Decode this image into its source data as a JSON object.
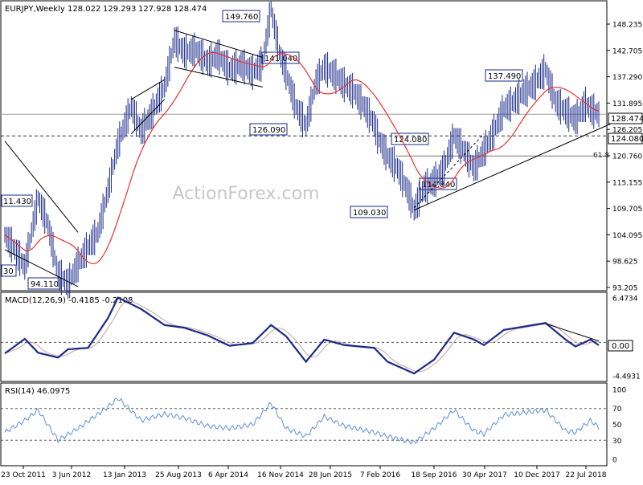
{
  "chart_data": {
    "type": "line",
    "symbol": "EURJPY",
    "timeframe": "Weekly",
    "ohlc_readout": {
      "open": "128.022",
      "high": "129.293",
      "low": "127.928",
      "close": "128.474"
    },
    "watermark": "ActionForex.com",
    "colors": {
      "price": "#1a2a8a",
      "sma": "#e8312f",
      "macd": "#1a2a8a",
      "signal": "#c8a0a0",
      "rsi": "#5b8fd9",
      "trendline": "#000000",
      "label_border": "#1a2a8a",
      "grid": "#808080"
    },
    "x_ticks": [
      "23 Oct 2011",
      "3 Jun 2012",
      "13 Jan 2013",
      "25 Aug 2013",
      "6 Apr 2014",
      "16 Nov 2014",
      "28 Jun 2015",
      "7 Feb 2016",
      "18 Sep 2016",
      "30 Apr 2017",
      "10 Dec 2017",
      "22 Jul 2018"
    ],
    "price_panel": {
      "ylim": [
        93.0,
        151.0
      ],
      "y_ticks": [
        "148.235",
        "142.705",
        "137.290",
        "131.895",
        "126.205",
        "120.760",
        "115.155",
        "109.705",
        "104.095",
        "98.625",
        "93.205"
      ],
      "last_price_label": "128.474",
      "level_label": "124.080",
      "level": 124.08,
      "fib_label": "61.8",
      "fib_level": 120.0,
      "swing_labels": [
        "149.760",
        "141.040",
        "126.090",
        "137.490",
        "124.080",
        "114.840",
        "109.030",
        "11.430",
        "94.110",
        "30"
      ],
      "key_points": [
        {
          "date": "2011-10-23",
          "value": 104.0
        },
        {
          "date": "2011-12-04",
          "value": 101.0
        },
        {
          "date": "2012-01-15",
          "value": 97.5
        },
        {
          "date": "2012-03-11",
          "value": 111.4
        },
        {
          "date": "2012-04-22",
          "value": 106.0
        },
        {
          "date": "2012-06-03",
          "value": 96.0
        },
        {
          "date": "2012-07-15",
          "value": 94.11
        },
        {
          "date": "2012-08-26",
          "value": 98.0
        },
        {
          "date": "2012-10-07",
          "value": 101.5
        },
        {
          "date": "2012-11-18",
          "value": 104.5
        },
        {
          "date": "2012-12-30",
          "value": 113.0
        },
        {
          "date": "2013-02-10",
          "value": 122.5
        },
        {
          "date": "2013-04-07",
          "value": 130.0
        },
        {
          "date": "2013-05-19",
          "value": 125.0
        },
        {
          "date": "2013-06-30",
          "value": 128.5
        },
        {
          "date": "2013-08-25",
          "value": 134.0
        },
        {
          "date": "2013-10-06",
          "value": 143.5
        },
        {
          "date": "2013-11-17",
          "value": 141.0
        },
        {
          "date": "2014-01-05",
          "value": 141.5
        },
        {
          "date": "2014-02-23",
          "value": 139.0
        },
        {
          "date": "2014-04-06",
          "value": 140.5
        },
        {
          "date": "2014-05-25",
          "value": 137.5
        },
        {
          "date": "2014-07-13",
          "value": 138.5
        },
        {
          "date": "2014-08-31",
          "value": 137.0
        },
        {
          "date": "2014-10-12",
          "value": 139.0
        },
        {
          "date": "2014-11-16",
          "value": 149.76
        },
        {
          "date": "2014-12-21",
          "value": 141.04
        },
        {
          "date": "2015-01-18",
          "value": 137.0
        },
        {
          "date": "2015-03-01",
          "value": 130.0
        },
        {
          "date": "2015-04-12",
          "value": 126.09
        },
        {
          "date": "2015-05-24",
          "value": 135.0
        },
        {
          "date": "2015-06-28",
          "value": 138.0
        },
        {
          "date": "2015-08-09",
          "value": 136.5
        },
        {
          "date": "2015-09-20",
          "value": 134.5
        },
        {
          "date": "2015-11-01",
          "value": 133.0
        },
        {
          "date": "2015-12-13",
          "value": 130.0
        },
        {
          "date": "2016-01-24",
          "value": 126.5
        },
        {
          "date": "2016-02-07",
          "value": 124.0
        },
        {
          "date": "2016-03-20",
          "value": 120.0
        },
        {
          "date": "2016-05-01",
          "value": 117.5
        },
        {
          "date": "2016-06-12",
          "value": 113.0
        },
        {
          "date": "2016-07-10",
          "value": 109.03
        },
        {
          "date": "2016-08-21",
          "value": 113.5
        },
        {
          "date": "2016-10-02",
          "value": 114.84
        },
        {
          "date": "2016-11-13",
          "value": 117.5
        },
        {
          "date": "2016-12-25",
          "value": 124.08
        },
        {
          "date": "2017-02-05",
          "value": 121.0
        },
        {
          "date": "2017-03-19",
          "value": 117.5
        },
        {
          "date": "2017-04-30",
          "value": 121.0
        },
        {
          "date": "2017-06-11",
          "value": 125.0
        },
        {
          "date": "2017-07-23",
          "value": 129.5
        },
        {
          "date": "2017-09-03",
          "value": 131.0
        },
        {
          "date": "2017-10-15",
          "value": 133.0
        },
        {
          "date": "2017-11-26",
          "value": 134.5
        },
        {
          "date": "2018-01-14",
          "value": 137.49
        },
        {
          "date": "2018-02-25",
          "value": 131.0
        },
        {
          "date": "2018-04-08",
          "value": 129.0
        },
        {
          "date": "2018-05-20",
          "value": 127.5
        },
        {
          "date": "2018-07-01",
          "value": 130.5
        },
        {
          "date": "2018-07-22",
          "value": 129.5
        },
        {
          "date": "2018-08-26",
          "value": 128.474
        }
      ]
    },
    "macd_panel": {
      "title": "MACD(12,26,9) -0.4185 -0.2108",
      "ylim": [
        -5.3,
        7.0
      ],
      "y_ticks": [
        "6.4734",
        "0.00",
        "-4.4931"
      ],
      "zero_label": "0.00",
      "key_points": [
        {
          "date": "2011-10-23",
          "value": -1.6
        },
        {
          "date": "2012-01-15",
          "value": 0.5
        },
        {
          "date": "2012-03-11",
          "value": -1.5
        },
        {
          "date": "2012-06-03",
          "value": -2.2
        },
        {
          "date": "2012-07-15",
          "value": -1.0
        },
        {
          "date": "2012-10-07",
          "value": -0.8
        },
        {
          "date": "2012-12-30",
          "value": 3.5
        },
        {
          "date": "2013-02-10",
          "value": 6.47
        },
        {
          "date": "2013-05-19",
          "value": 4.8
        },
        {
          "date": "2013-08-25",
          "value": 2.5
        },
        {
          "date": "2013-11-17",
          "value": 2.1
        },
        {
          "date": "2014-02-23",
          "value": 1.0
        },
        {
          "date": "2014-05-25",
          "value": -0.5
        },
        {
          "date": "2014-08-31",
          "value": -0.1
        },
        {
          "date": "2014-11-16",
          "value": 2.5
        },
        {
          "date": "2015-01-18",
          "value": 0.9
        },
        {
          "date": "2015-04-12",
          "value": -2.8
        },
        {
          "date": "2015-06-28",
          "value": 0.4
        },
        {
          "date": "2015-09-20",
          "value": -0.4
        },
        {
          "date": "2016-01-24",
          "value": -0.8
        },
        {
          "date": "2016-03-20",
          "value": -2.8
        },
        {
          "date": "2016-07-10",
          "value": -4.5
        },
        {
          "date": "2016-10-02",
          "value": -2.5
        },
        {
          "date": "2016-12-25",
          "value": 1.4
        },
        {
          "date": "2017-03-19",
          "value": 0.4
        },
        {
          "date": "2017-04-30",
          "value": -0.4
        },
        {
          "date": "2017-07-23",
          "value": 1.8
        },
        {
          "date": "2018-01-14",
          "value": 2.8
        },
        {
          "date": "2018-04-08",
          "value": 0.4
        },
        {
          "date": "2018-05-20",
          "value": -0.6
        },
        {
          "date": "2018-07-22",
          "value": 0.4
        },
        {
          "date": "2018-08-26",
          "value": -0.42
        }
      ]
    },
    "rsi_panel": {
      "title": "RSI(14) 46.0975",
      "ylim": [
        0,
        100
      ],
      "y_ticks": [
        "100",
        "70",
        "50",
        "30",
        "0"
      ],
      "levels": [
        70,
        30
      ],
      "key_points": [
        {
          "date": "2011-10-23",
          "value": 40
        },
        {
          "date": "2012-01-15",
          "value": 55
        },
        {
          "date": "2012-03-11",
          "value": 68
        },
        {
          "date": "2012-06-03",
          "value": 30
        },
        {
          "date": "2012-08-26",
          "value": 45
        },
        {
          "date": "2012-12-30",
          "value": 72
        },
        {
          "date": "2013-02-10",
          "value": 83
        },
        {
          "date": "2013-05-19",
          "value": 55
        },
        {
          "date": "2013-08-25",
          "value": 63
        },
        {
          "date": "2013-11-17",
          "value": 58
        },
        {
          "date": "2014-02-23",
          "value": 48
        },
        {
          "date": "2014-05-25",
          "value": 45
        },
        {
          "date": "2014-08-31",
          "value": 50
        },
        {
          "date": "2014-11-16",
          "value": 77
        },
        {
          "date": "2015-01-18",
          "value": 45
        },
        {
          "date": "2015-04-12",
          "value": 35
        },
        {
          "date": "2015-06-28",
          "value": 60
        },
        {
          "date": "2015-09-20",
          "value": 48
        },
        {
          "date": "2016-01-24",
          "value": 40
        },
        {
          "date": "2016-03-20",
          "value": 35
        },
        {
          "date": "2016-07-10",
          "value": 27
        },
        {
          "date": "2016-10-02",
          "value": 45
        },
        {
          "date": "2016-12-25",
          "value": 68
        },
        {
          "date": "2017-03-19",
          "value": 42
        },
        {
          "date": "2017-04-30",
          "value": 38
        },
        {
          "date": "2017-07-23",
          "value": 62
        },
        {
          "date": "2018-01-14",
          "value": 68
        },
        {
          "date": "2018-04-08",
          "value": 42
        },
        {
          "date": "2018-05-20",
          "value": 40
        },
        {
          "date": "2018-07-22",
          "value": 55
        },
        {
          "date": "2018-08-26",
          "value": 46.1
        }
      ]
    }
  }
}
